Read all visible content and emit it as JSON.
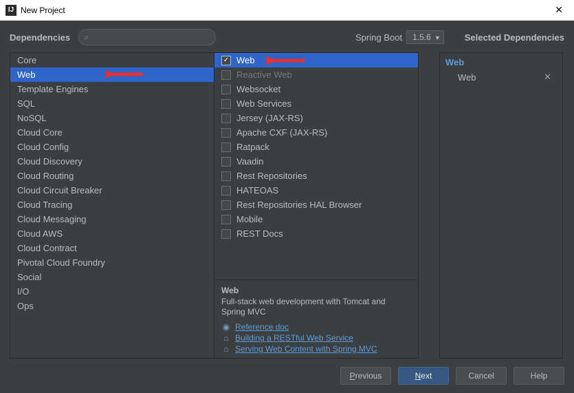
{
  "window": {
    "title": "New Project"
  },
  "header": {
    "dependencies_label": "Dependencies",
    "search_placeholder": "",
    "spring_boot_label": "Spring Boot",
    "version": "1.5.6"
  },
  "categories": [
    "Core",
    "Web",
    "Template Engines",
    "SQL",
    "NoSQL",
    "Cloud Core",
    "Cloud Config",
    "Cloud Discovery",
    "Cloud Routing",
    "Cloud Circuit Breaker",
    "Cloud Tracing",
    "Cloud Messaging",
    "Cloud AWS",
    "Cloud Contract",
    "Pivotal Cloud Foundry",
    "Social",
    "I/O",
    "Ops"
  ],
  "selected_category_index": 1,
  "dependencies": [
    {
      "label": "Web",
      "checked": true,
      "selected": true,
      "disabled": false
    },
    {
      "label": "Reactive Web",
      "checked": false,
      "disabled": true
    },
    {
      "label": "Websocket",
      "checked": false,
      "disabled": false
    },
    {
      "label": "Web Services",
      "checked": false,
      "disabled": false
    },
    {
      "label": "Jersey (JAX-RS)",
      "checked": false,
      "disabled": false
    },
    {
      "label": "Apache CXF (JAX-RS)",
      "checked": false,
      "disabled": false
    },
    {
      "label": "Ratpack",
      "checked": false,
      "disabled": false
    },
    {
      "label": "Vaadin",
      "checked": false,
      "disabled": false
    },
    {
      "label": "Rest Repositories",
      "checked": false,
      "disabled": false
    },
    {
      "label": "HATEOAS",
      "checked": false,
      "disabled": false
    },
    {
      "label": "Rest Repositories HAL Browser",
      "checked": false,
      "disabled": false
    },
    {
      "label": "Mobile",
      "checked": false,
      "disabled": false
    },
    {
      "label": "REST Docs",
      "checked": false,
      "disabled": false
    }
  ],
  "info": {
    "title": "Web",
    "description": "Full-stack web development with Tomcat and Spring MVC",
    "links": [
      {
        "icon": "doc",
        "label": "Reference doc"
      },
      {
        "icon": "home",
        "label": "Building a RESTful Web Service"
      },
      {
        "icon": "home",
        "label": "Serving Web Content with Spring MVC"
      }
    ]
  },
  "selected_panel": {
    "header": "Selected Dependencies",
    "groups": [
      {
        "category": "Web",
        "items": [
          "Web"
        ]
      }
    ]
  },
  "buttons": {
    "previous": "Previous",
    "next": "Next",
    "cancel": "Cancel",
    "help": "Help"
  }
}
